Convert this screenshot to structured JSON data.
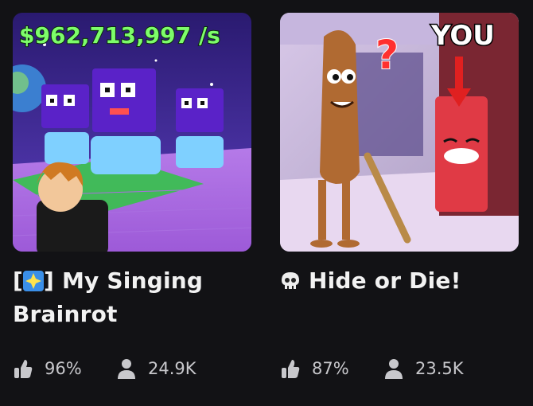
{
  "games": [
    {
      "title_prefix": "[",
      "title_suffix": "] My Singing Brainrot",
      "thumbnail_text": "$962,713,997 /s",
      "rating": "96%",
      "players": "24.9K"
    },
    {
      "title_prefix": "",
      "title_suffix": "Hide or Die!",
      "thumbnail_text": "YOU",
      "rating": "87%",
      "players": "23.5K"
    }
  ],
  "icons": {
    "rating": "thumbs-up-icon",
    "players": "person-icon",
    "badge": "sparkle-badge-icon",
    "skull": "skull-icon"
  },
  "colors": {
    "background": "#121215",
    "title": "#f2f2f2",
    "stats": "#c8c8cc"
  }
}
